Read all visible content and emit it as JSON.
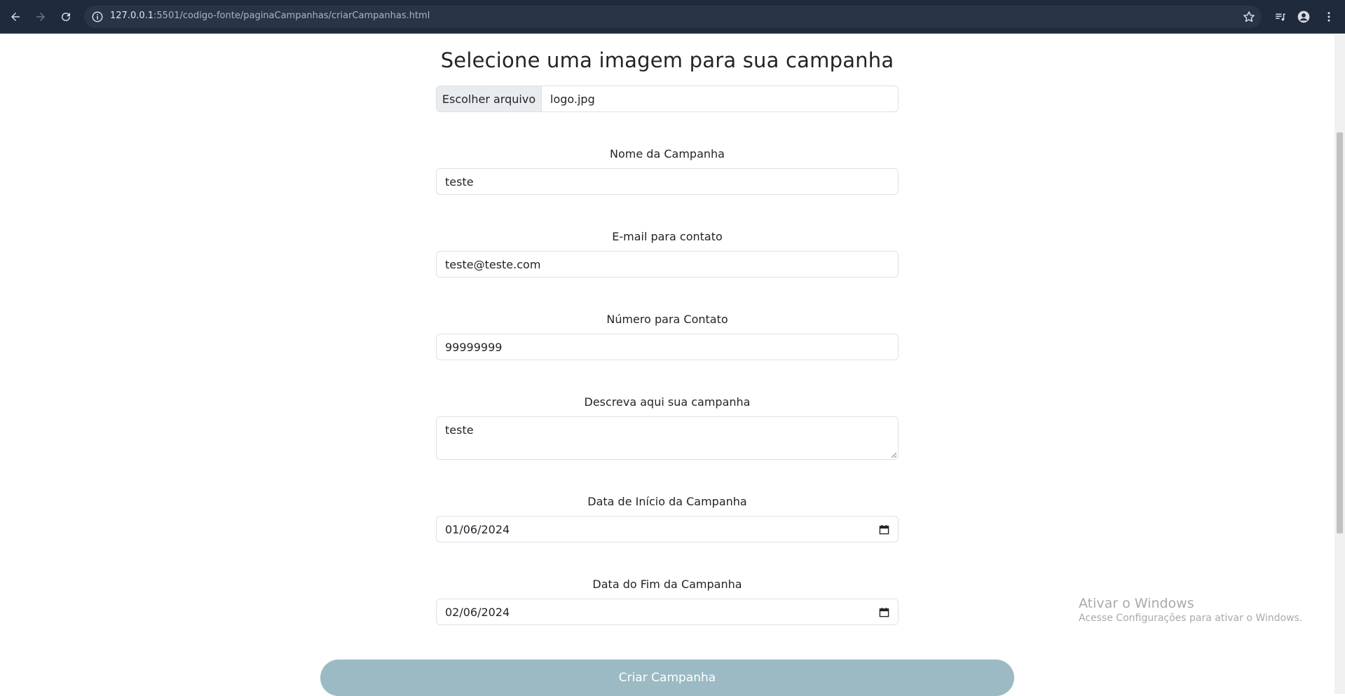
{
  "browser": {
    "url_host": "127.0.0.1",
    "url_path": ":5501/codigo-fonte/paginaCampanhas/criarCampanhas.html"
  },
  "page": {
    "heading": "Selecione uma imagem para sua campanha",
    "file_input": {
      "button_label": "Escolher arquivo",
      "file_name": "logo.jpg"
    },
    "fields": {
      "name": {
        "label": "Nome da Campanha",
        "value": "teste"
      },
      "email": {
        "label": "E-mail para contato",
        "value": "teste@teste.com"
      },
      "phone": {
        "label": "Número para Contato",
        "value": "99999999"
      },
      "description": {
        "label": "Descreva aqui sua campanha",
        "value": "teste"
      },
      "start_date": {
        "label": "Data de Início da Campanha",
        "value": "01/06/2024"
      },
      "end_date": {
        "label": "Data do Fim da Campanha",
        "value": "02/06/2024"
      }
    },
    "submit_label": "Criar Campanha"
  },
  "watermark": {
    "title": "Ativar o Windows",
    "subtitle": "Acesse Configurações para ativar o Windows."
  },
  "colors": {
    "browser_bar": "#1f2a3c",
    "submit_button": "#9bbac4"
  }
}
